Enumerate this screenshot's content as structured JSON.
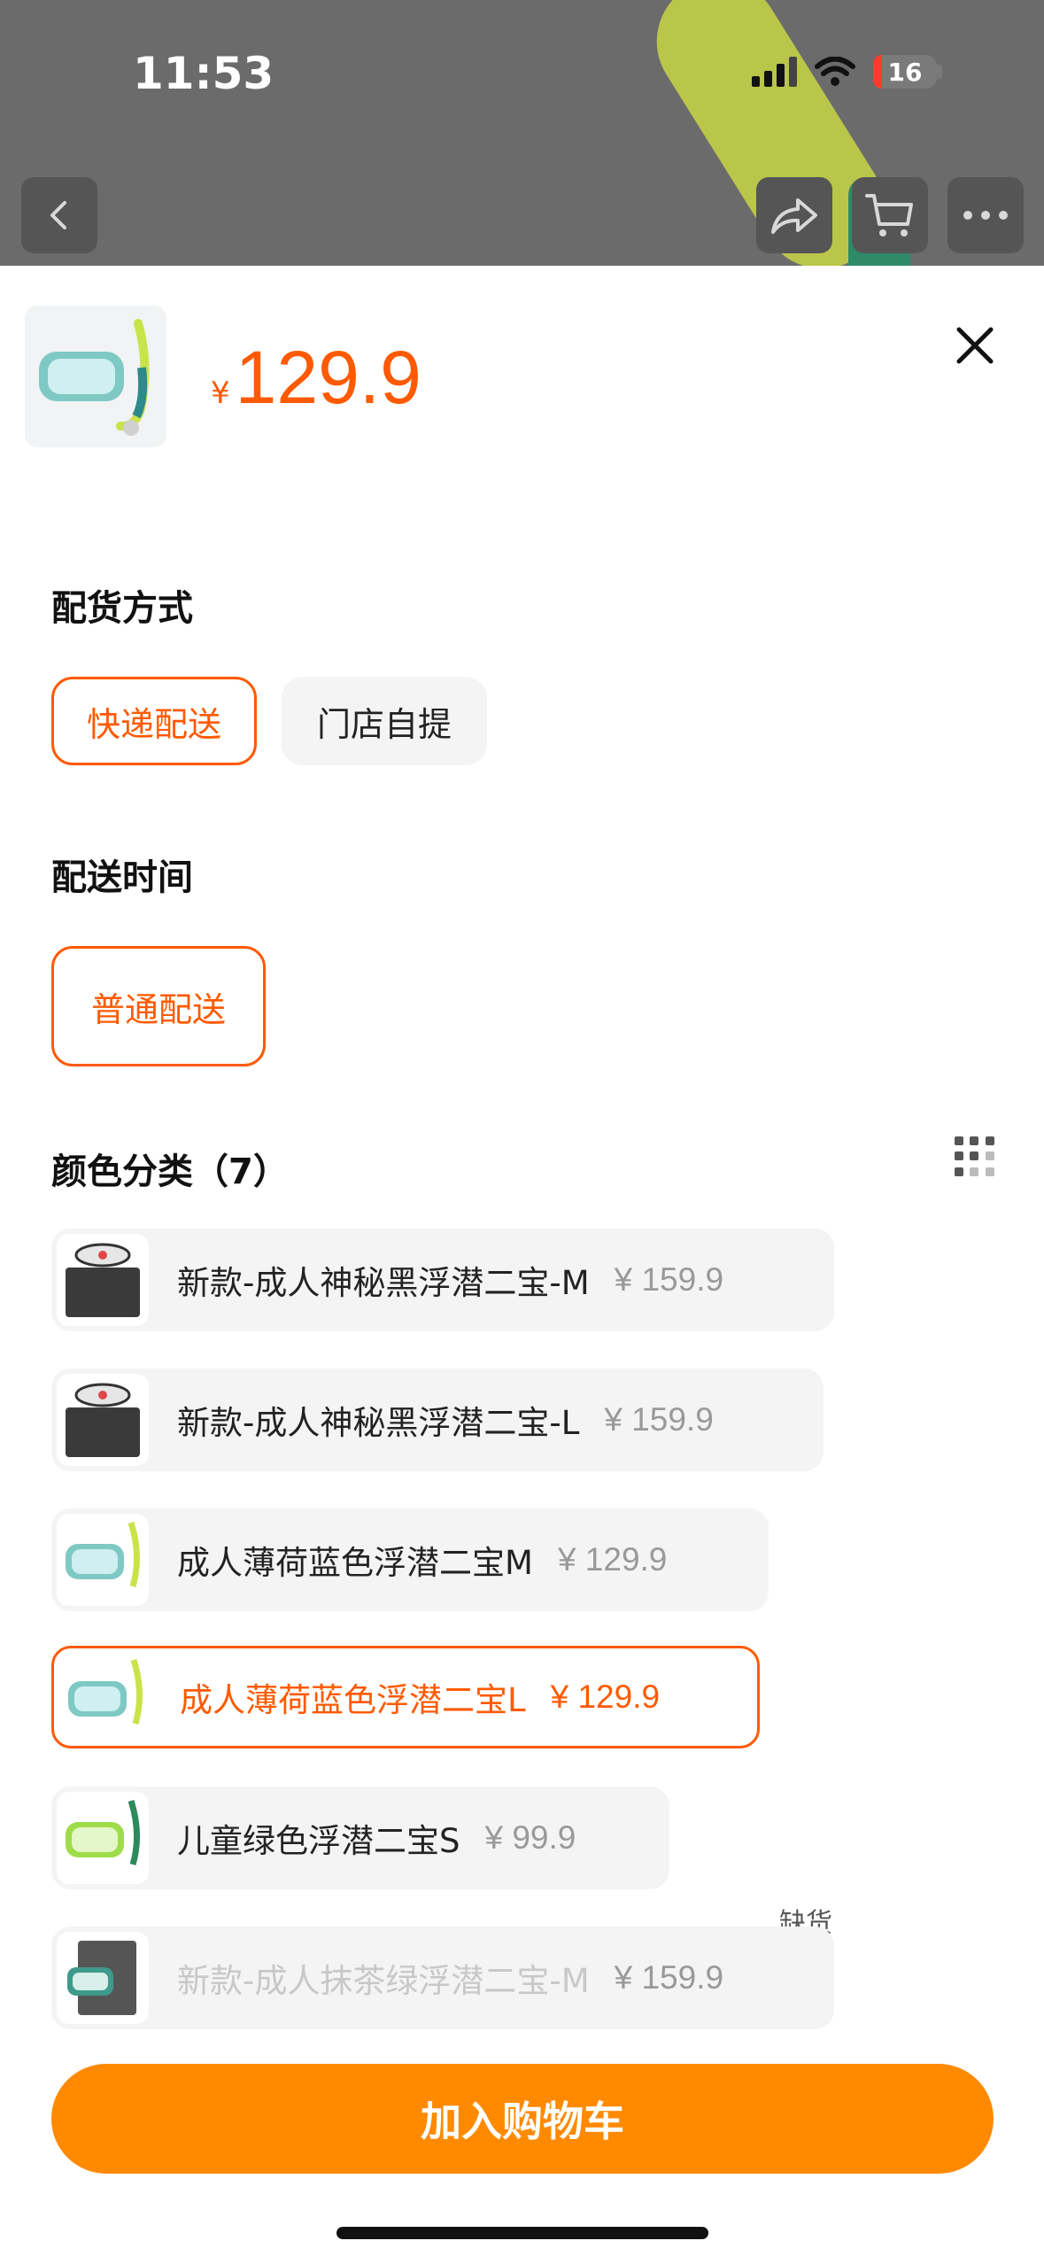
{
  "status_bar": {
    "time": "11:53",
    "battery": "16"
  },
  "header": {
    "back": "back-icon",
    "share": "share-icon",
    "cart": "cart-icon",
    "more": "more-icon"
  },
  "product": {
    "currency": "¥",
    "price": "129.9"
  },
  "delivery_method": {
    "title": "配货方式",
    "options": [
      {
        "label": "快递配送",
        "selected": true
      },
      {
        "label": "门店自提",
        "selected": false
      }
    ]
  },
  "delivery_time": {
    "title": "配送时间",
    "options": [
      {
        "label": "普通配送",
        "selected": true
      }
    ]
  },
  "color": {
    "title": "颜色分类（7）",
    "options": [
      {
        "name": "新款-成人神秘黑浮潜二宝-M",
        "price": "¥ 159.9"
      },
      {
        "name": "新款-成人神秘黑浮潜二宝-L",
        "price": "¥ 159.9"
      },
      {
        "name": "成人薄荷蓝色浮潜二宝M",
        "price": "¥ 129.9"
      },
      {
        "name": "成人薄荷蓝色浮潜二宝L",
        "price": "¥ 129.9"
      },
      {
        "name": "儿童绿色浮潜二宝S",
        "price": "¥ 99.9"
      },
      {
        "name": "新款-成人抹茶绿浮潜二宝-M",
        "price": "¥ 159.9"
      }
    ],
    "selected_index": 3,
    "out_of_stock_label": "缺货"
  },
  "add_to_cart": "加入购物车",
  "colors": {
    "accent": "#ff5a00",
    "button": "#ff8a00"
  }
}
